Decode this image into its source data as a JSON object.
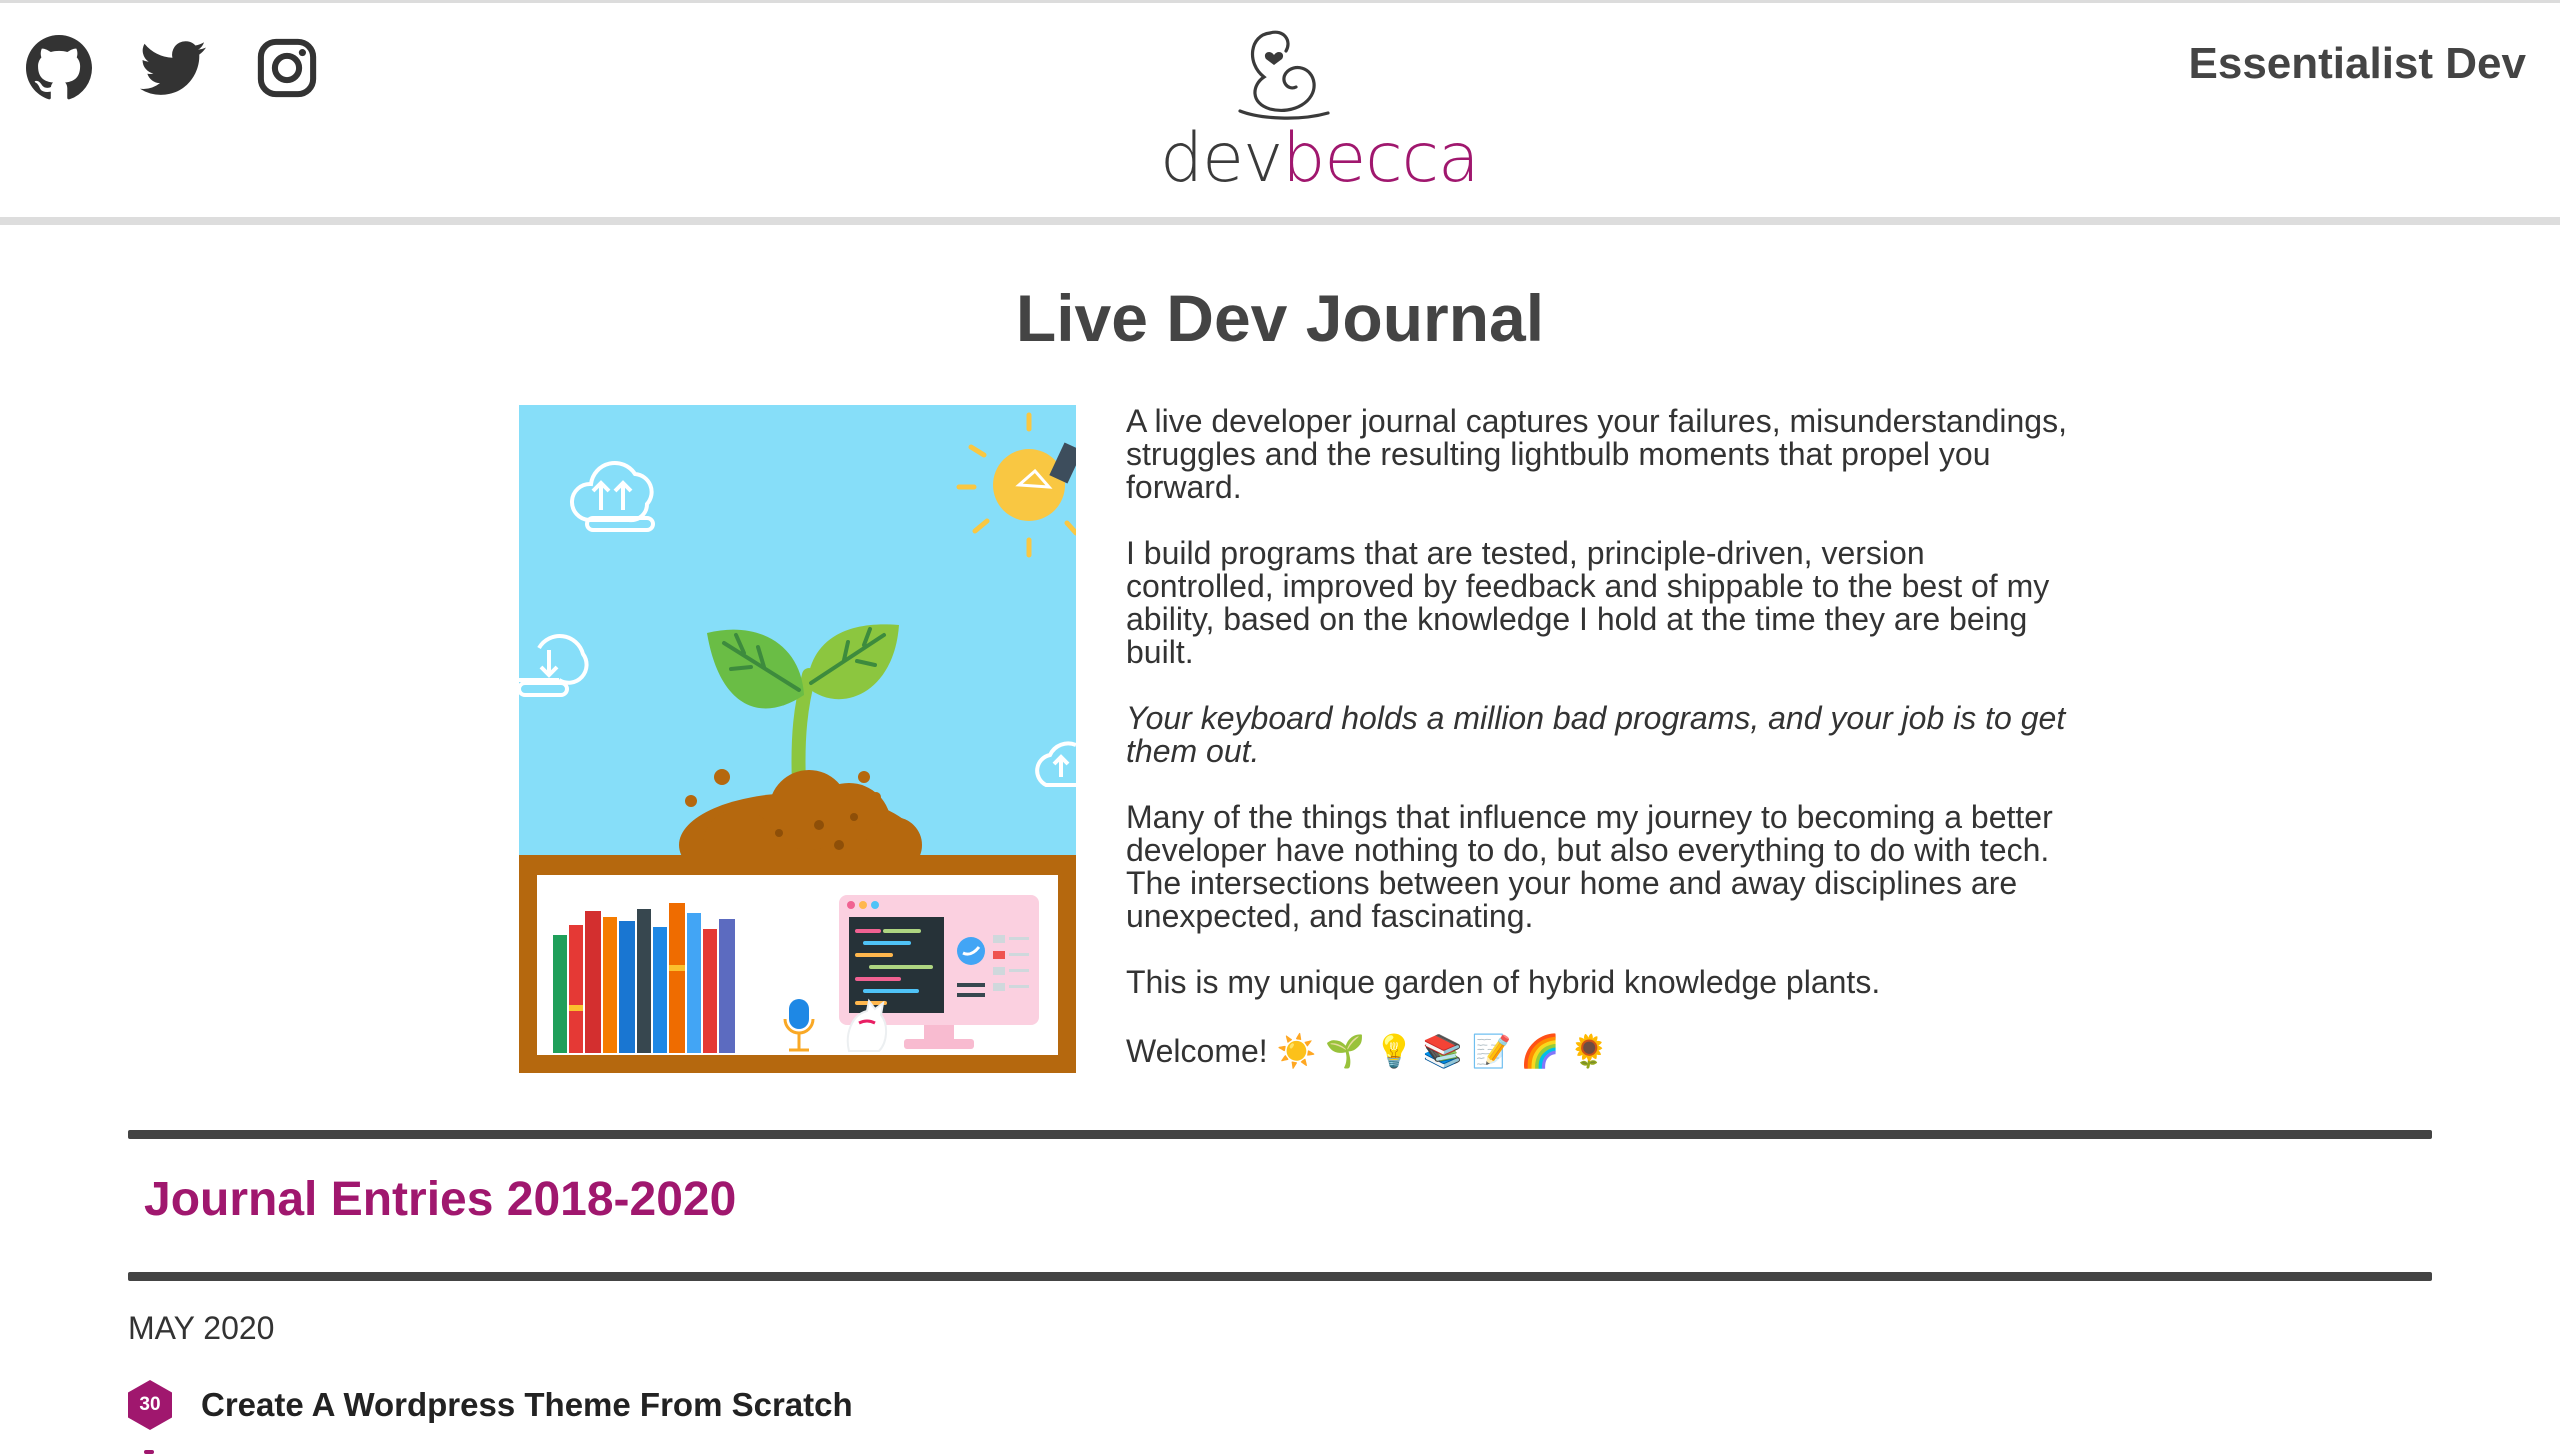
{
  "header": {
    "social": [
      {
        "icon": "github-icon"
      },
      {
        "icon": "twitter-icon"
      },
      {
        "icon": "instagram-icon"
      }
    ],
    "logo": {
      "part1": "dev",
      "part2": "becca"
    },
    "site_title": "Essentialist Dev"
  },
  "main": {
    "title": "Live Dev Journal",
    "intro": {
      "p1": "A live developer journal captures your failures, misunderstandings, struggles and the resulting lightbulb moments that propel you forward.",
      "p2": "I build programs that are tested, principle-driven, version controlled, improved by feedback and shippable to the best of my ability, based on the knowledge I hold at the time they are being built.",
      "p3": "Your keyboard holds a million bad programs, and your job is to get them out.",
      "p4": "Many of the things that influence my journey to becoming a better developer have nothing to do, but also everything to do with tech. The intersections between your home and away disciplines are unexpected, and fascinating.",
      "p5": "This is my unique garden of hybrid knowledge plants.",
      "welcome": "Welcome! ☀️ 🌱 💡 📚 📝 🌈 🌻"
    },
    "journal": {
      "heading": "Journal Entries 2018-2020",
      "month": "MAY 2020",
      "entries": [
        {
          "day": "30",
          "title": "Create A Wordpress Theme From Scratch"
        }
      ]
    }
  },
  "colors": {
    "brand": "#a0176e",
    "text": "#333333",
    "rule": "#444444",
    "sky": "#86def9",
    "shelf": "#b5680e"
  }
}
